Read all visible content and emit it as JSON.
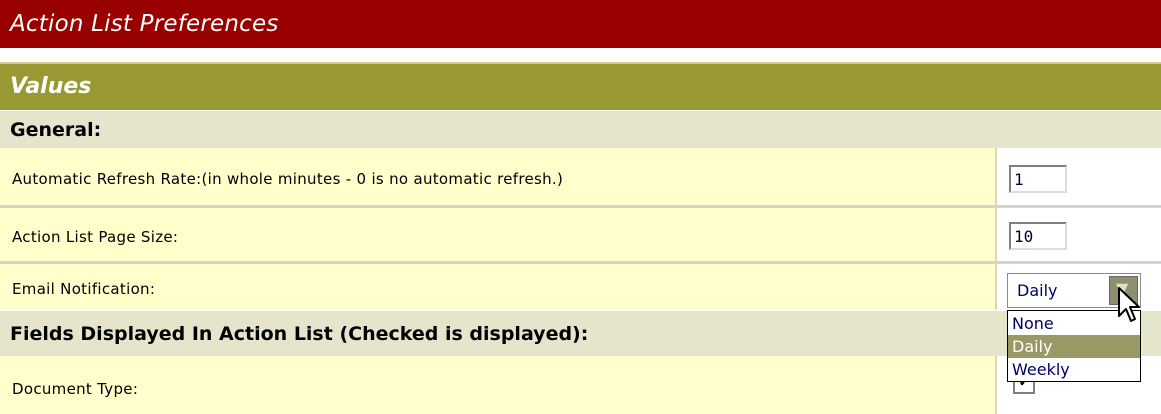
{
  "header": {
    "title": "Action List Preferences"
  },
  "values_bar": {
    "title": "Values"
  },
  "sections": {
    "general": "General:",
    "fields": "Fields Displayed In Action List (Checked is displayed):"
  },
  "rows": {
    "refresh_rate": {
      "label": "Automatic Refresh Rate:(in whole minutes - 0 is no automatic refresh.)",
      "value": "1"
    },
    "page_size": {
      "label": "Action List Page Size:",
      "value": "10"
    },
    "email_notification": {
      "label": "Email Notification:",
      "selected": "Daily",
      "options": [
        "None",
        "Daily",
        "Weekly"
      ]
    },
    "document_type": {
      "label": "Document Type:",
      "checked": true
    }
  },
  "colors": {
    "title_bg": "#990000",
    "values_bg": "#999933",
    "section_bg": "#e5e5cc",
    "row_bg": "#ffffcc"
  }
}
